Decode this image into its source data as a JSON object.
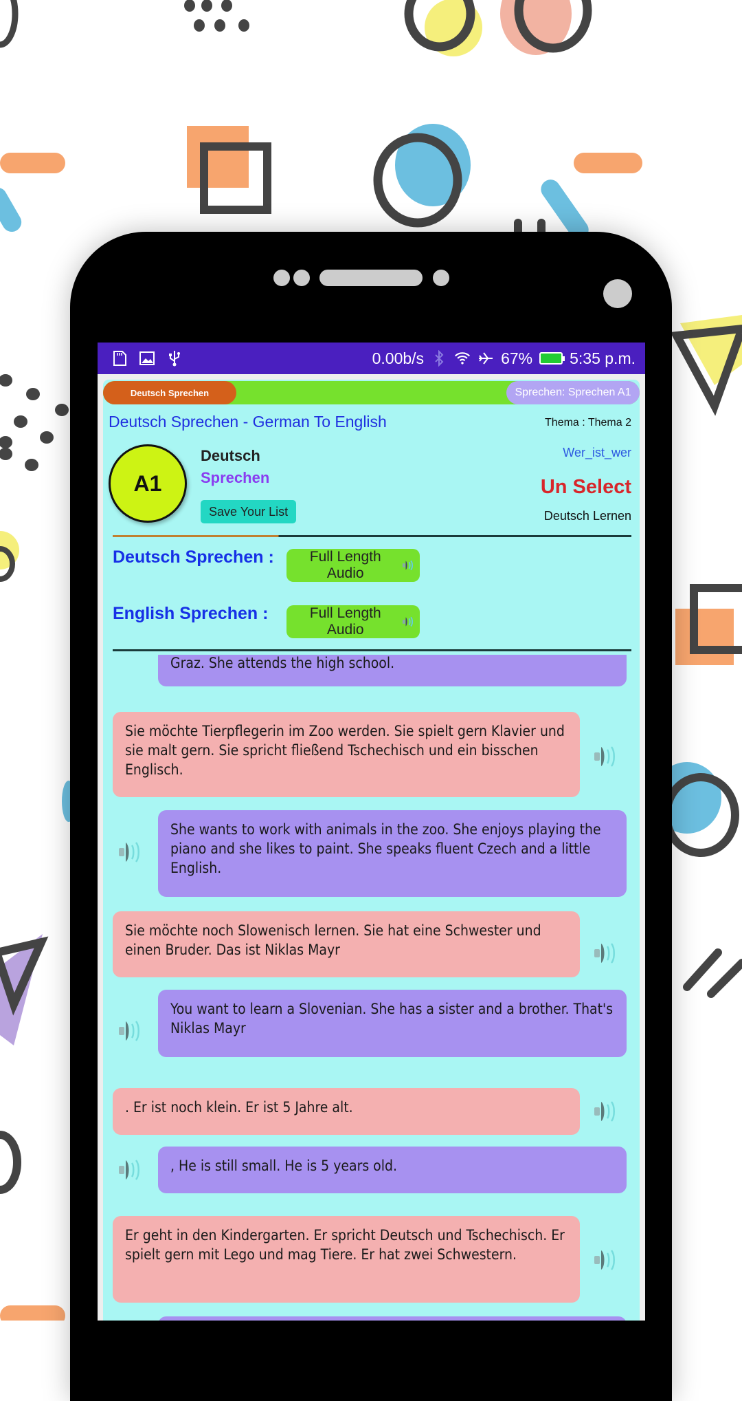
{
  "status_bar": {
    "left_icons": [
      "sd-card-icon",
      "image-icon",
      "usb-icon"
    ],
    "net_speed": "0.00b/s",
    "battery": "67%",
    "time": "5:35 p.m."
  },
  "topbar": {
    "left_pill": "Deutsch Sprechen",
    "right_pill": "Sprechen: Sprechen A1"
  },
  "header": {
    "title": "Deutsch Sprechen - German To English",
    "thema": "Thema : Thema 2",
    "level": "A1",
    "label_deutsch": "Deutsch",
    "label_sprechen": "Sprechen",
    "save_button": "Save Your List",
    "topic_link": "Wer_ist_wer",
    "unselect": "Un Select",
    "deutsch_lernen": "Deutsch Lernen"
  },
  "audio": {
    "deutsch_label": "Deutsch Sprechen :",
    "english_label": "English  Sprechen :",
    "button_label": "Full Length Audio"
  },
  "colors": {
    "status_bar": "#4a1fbf",
    "app_bg": "#a9f6f3",
    "german_bubble": "#f4b0b0",
    "english_bubble": "#a791f0",
    "accent_green": "#76e12d",
    "unselect_red": "#d8262a"
  },
  "sentences": [
    {
      "lang": "en",
      "text": "Graz. She attends the high school."
    },
    {
      "lang": "de",
      "text": "Sie möchte Tierpflegerin im Zoo werden. Sie spielt gern Klavier und sie malt gern. Sie spricht fließend Tschechisch und ein bisschen Englisch."
    },
    {
      "lang": "en",
      "text": "She wants to work with animals in the zoo. She enjoys playing the piano and she likes to paint. She speaks fluent Czech and a little English."
    },
    {
      "lang": "de",
      "text": "Sie möchte noch Slowenisch lernen. Sie hat eine Schwester und einen Bruder. Das ist Niklas Mayr"
    },
    {
      "lang": "en",
      "text": "You want to learn a Slovenian. She has a sister and a brother. That's Niklas Mayr"
    },
    {
      "lang": "de",
      "text": ". Er ist noch klein. Er ist 5 Jahre alt."
    },
    {
      "lang": "en",
      "text": ", He is still small. He is 5 years old."
    },
    {
      "lang": "de",
      "text": "Er geht in den Kindergarten. Er spricht Deutsch und Tschechisch. Er spielt gern mit Lego und mag Tiere. Er hat zwei Schwestern."
    },
    {
      "lang": "en",
      "text": ""
    }
  ]
}
